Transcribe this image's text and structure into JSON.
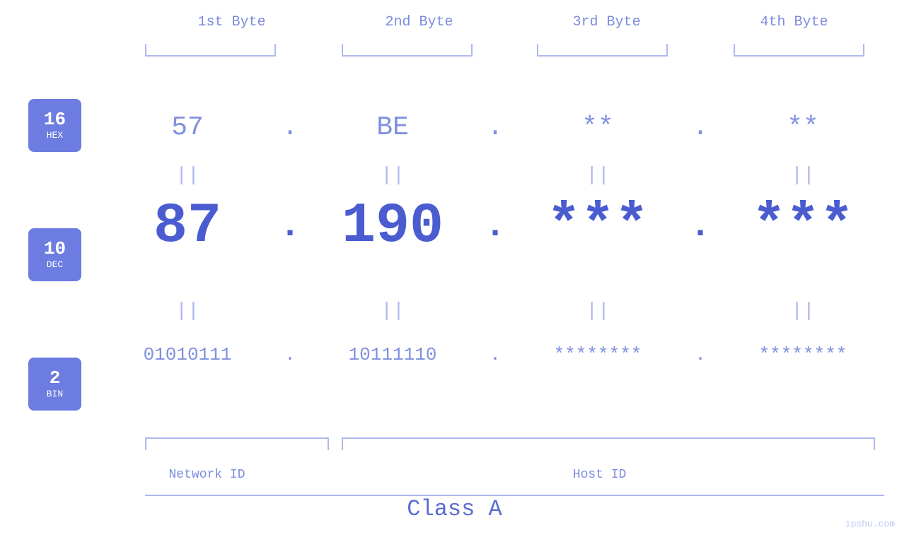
{
  "page": {
    "background": "#ffffff",
    "watermark": "ipshu.com"
  },
  "headers": {
    "byte1": "1st Byte",
    "byte2": "2nd Byte",
    "byte3": "3rd Byte",
    "byte4": "4th Byte"
  },
  "bases": [
    {
      "number": "16",
      "label": "HEX"
    },
    {
      "number": "10",
      "label": "DEC"
    },
    {
      "number": "2",
      "label": "BIN"
    }
  ],
  "rows": {
    "hex": {
      "b1": "57",
      "b2": "BE",
      "b3": "**",
      "b4": "**",
      "dot": "."
    },
    "dec": {
      "b1": "87",
      "b2": "190",
      "b3": "***",
      "b4": "***",
      "dot": "."
    },
    "bin": {
      "b1": "01010111",
      "b2": "10111110",
      "b3": "********",
      "b4": "********",
      "dot": "."
    },
    "equals": "||"
  },
  "labels": {
    "network_id": "Network ID",
    "host_id": "Host ID",
    "class": "Class A"
  }
}
